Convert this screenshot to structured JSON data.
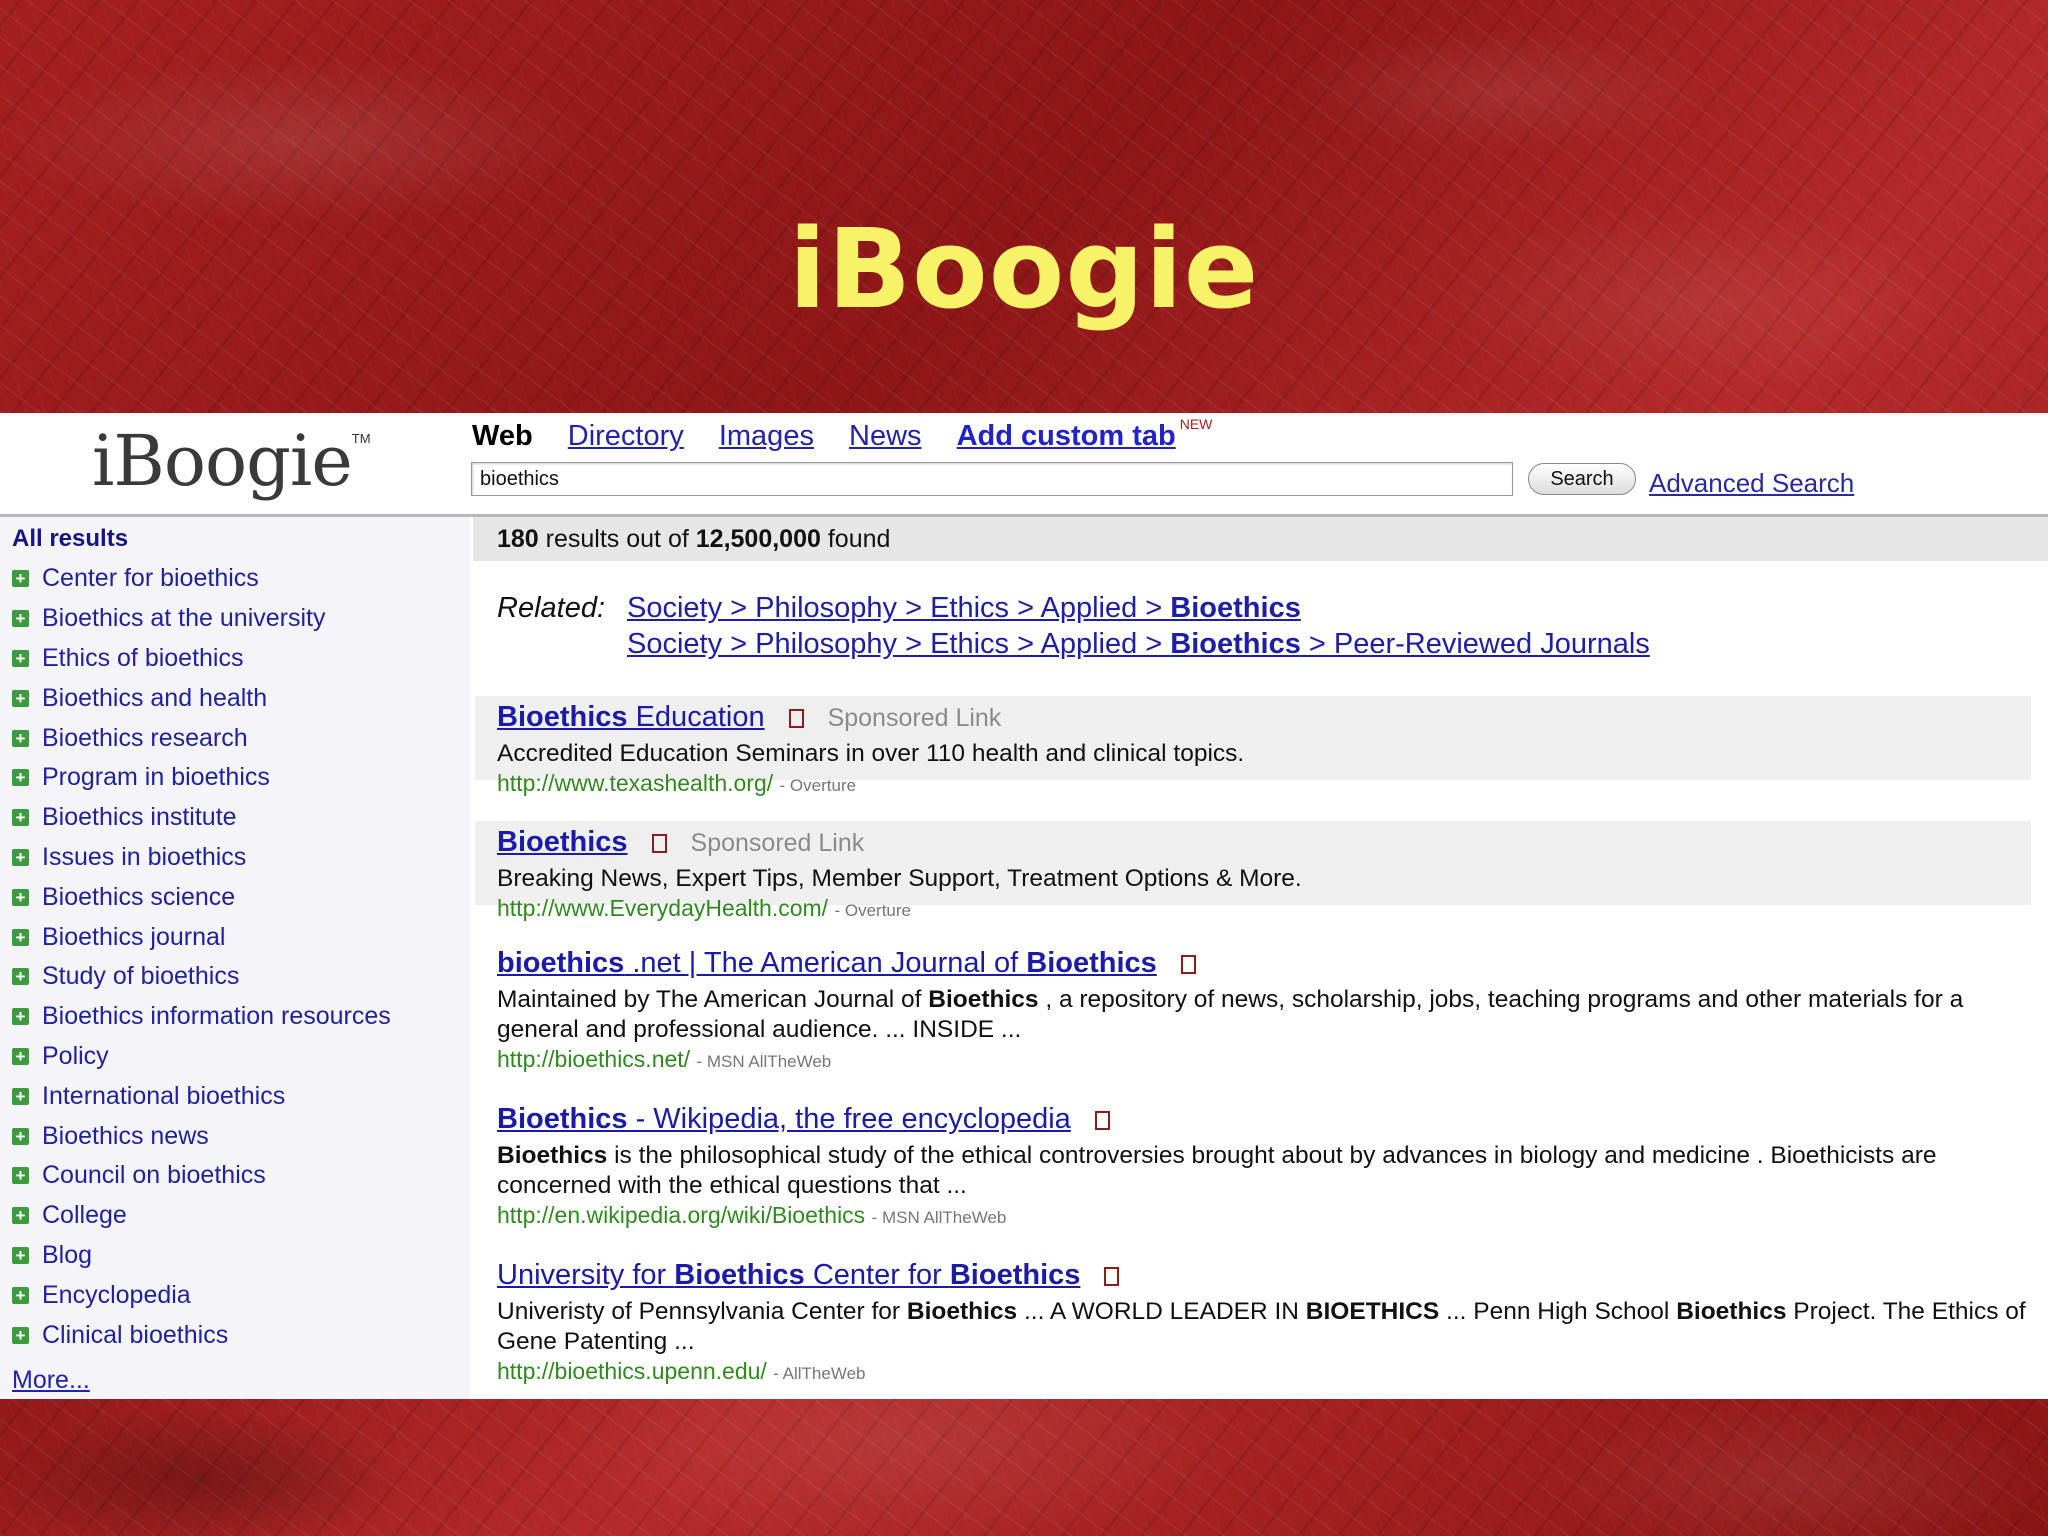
{
  "slide": {
    "title": "iBoogie"
  },
  "logo": {
    "text": "iBoogie",
    "tm": "TM"
  },
  "tabs": {
    "web": "Web",
    "directory": "Directory",
    "images": "Images",
    "news": "News",
    "custom": "Add custom tab",
    "new_badge": "NEW"
  },
  "search": {
    "value": "bioethics",
    "button": "Search",
    "advanced": "Advanced Search"
  },
  "sidebar": {
    "all_results": "All results",
    "clusters": [
      "Center for bioethics",
      "Bioethics at the university",
      "Ethics of bioethics",
      "Bioethics and health",
      "Bioethics research",
      "Program in bioethics",
      "Bioethics institute",
      "Issues in bioethics",
      "Bioethics science",
      "Bioethics journal",
      "Study of bioethics",
      "Bioethics information resources",
      "Policy",
      "International bioethics",
      "Bioethics news",
      "Council on bioethics",
      "College",
      "Blog",
      "Encyclopedia",
      "Clinical bioethics"
    ],
    "more": "More..."
  },
  "results_summary": {
    "count": "180",
    "middle": "results out of",
    "total": "12,500,000",
    "suffix": "found"
  },
  "related": {
    "label": "Related:",
    "path1": "Society > Philosophy > Ethics > Applied > ",
    "path1_bold": "Bioethics",
    "path2": "Society > Philosophy > Ethics > Applied > ",
    "path2_bold": "Bioethics",
    "path2_tail": " > Peer-Reviewed Journals"
  },
  "results": [
    {
      "title_bold": "Bioethics",
      "title_rest": " Education",
      "sponsored": "Sponsored Link",
      "snippet": "Accredited Education Seminars in over 110 health and clinical topics.",
      "url": "http://www.texashealth.org/",
      "source": "- Overture"
    },
    {
      "title_bold": "Bioethics",
      "sponsored": "Sponsored Link",
      "snippet": "Breaking News, Expert Tips, Member Support, Treatment Options & More.",
      "url": "http://www.EverydayHealth.com/",
      "source": "- Overture"
    },
    {
      "title_a": "bioethics",
      "title_b": " .net | The American Journal of ",
      "title_c": "Bioethics",
      "snippet_a": "Maintained by The American Journal of ",
      "snippet_b": "Bioethics",
      "snippet_c": " , a repository of news, scholarship, jobs, teaching programs and other materials for a general and professional audience. ... INSIDE ...",
      "url": "http://bioethics.net/",
      "source": "- MSN AllTheWeb"
    },
    {
      "title_a": "Bioethics",
      "title_b": " - Wikipedia, the free encyclopedia",
      "snippet_a": "Bioethics",
      "snippet_b": " is the philosophical study of the ethical controversies brought about by advances in biology and medicine . Bioethicists are concerned with the ethical questions that ...",
      "url": "http://en.wikipedia.org/wiki/Bioethics",
      "source": "- MSN AllTheWeb"
    },
    {
      "title_a": "University for ",
      "title_b": "Bioethics",
      "title_c": " Center for ",
      "title_d": "Bioethics",
      "snippet_a": "Univeristy of Pennsylvania Center for ",
      "snippet_b": "Bioethics",
      "snippet_c": " ... A WORLD LEADER IN ",
      "snippet_d": "BIOETHICS",
      "snippet_e": " ... Penn High School ",
      "snippet_f": "Bioethics",
      "snippet_g": " Project. The Ethics of Gene Patenting ...",
      "url": "http://bioethics.upenn.edu/",
      "source": "- AllTheWeb"
    }
  ]
}
